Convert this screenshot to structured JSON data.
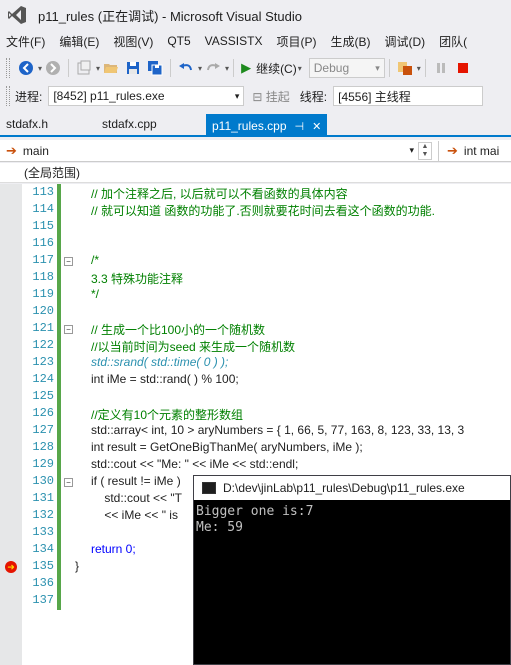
{
  "window": {
    "title": "p11_rules (正在调试) - Microsoft Visual Studio"
  },
  "menu": [
    "文件(F)",
    "编辑(E)",
    "视图(V)",
    "QT5",
    "VASSISTX",
    "项目(P)",
    "生成(B)",
    "调试(D)",
    "团队("
  ],
  "toolbar": {
    "continue_label": "继续(C)",
    "config_value": "Debug"
  },
  "process_bar": {
    "process_label": "进程:",
    "process_value": "[8452] p11_rules.exe",
    "suspend_label": "挂起",
    "thread_label": "线程:",
    "thread_value": "[4556] 主线程"
  },
  "tabs": [
    {
      "label": "stdafx.h"
    },
    {
      "label": "stdafx.cpp"
    },
    {
      "label": "p11_rules.cpp",
      "pin": "⊣",
      "close": "✕"
    }
  ],
  "navbar": {
    "function_value": "main",
    "right_value": "int mai",
    "scope": "(全局范围)"
  },
  "code_lines": [
    {
      "num": "113",
      "text": "// 加个注释之后, 以后就可以不看函数的具体内容"
    },
    {
      "num": "114",
      "text": "// 就可以知道 函数的功能了.否则就要花时间去看这个函数的功能."
    },
    {
      "num": "115",
      "text": ""
    },
    {
      "num": "116",
      "text": ""
    },
    {
      "num": "117",
      "text": "/*"
    },
    {
      "num": "118",
      "text": "3.3 特殊功能注释"
    },
    {
      "num": "119",
      "text": "*/"
    },
    {
      "num": "120",
      "text": ""
    },
    {
      "num": "121",
      "text": "// 生成一个比100小的一个随机数"
    },
    {
      "num": "122",
      "text": "//以当前时间为seed 来生成一个随机数"
    },
    {
      "num": "123",
      "text": "std::srand( std::time( 0 ) );"
    },
    {
      "num": "124",
      "text": "int iMe = std::rand( ) % 100;"
    },
    {
      "num": "125",
      "text": ""
    },
    {
      "num": "126",
      "text": "//定义有10个元素的整形数组"
    },
    {
      "num": "127",
      "text": "std::array< int, 10 > aryNumbers = { 1, 66, 5, 77, 163, 8, 123, 33, 13, 3"
    },
    {
      "num": "128",
      "text": "int result = GetOneBigThanMe( aryNumbers, iMe );"
    },
    {
      "num": "129",
      "text": "std::cout << \"Me: \" << iMe << std::endl;"
    },
    {
      "num": "130",
      "text": "if ( result != iMe )"
    },
    {
      "num": "131",
      "text": "    std::cout << \"T"
    },
    {
      "num": "132",
      "text": "    << iMe << \" is"
    },
    {
      "num": "133",
      "text": ""
    },
    {
      "num": "134",
      "text": "return 0;"
    },
    {
      "num": "135",
      "text": "}"
    },
    {
      "num": "136",
      "text": ""
    },
    {
      "num": "137",
      "text": ""
    }
  ],
  "console": {
    "title": "D:\\dev\\jinLab\\p11_rules\\Debug\\p11_rules.exe",
    "lines": [
      "Bigger one is:7",
      "Me: 59"
    ]
  }
}
